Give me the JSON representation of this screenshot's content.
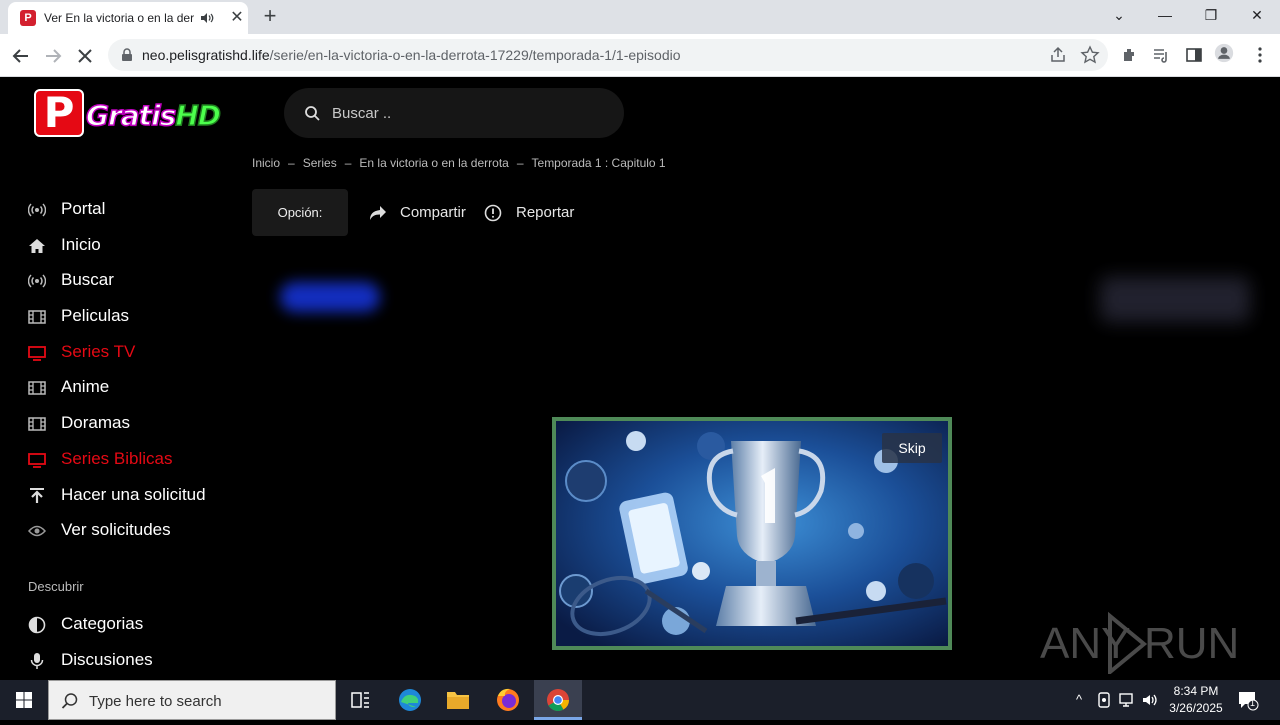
{
  "browser": {
    "tab_title": "Ver En la victoria o en la derrota",
    "url_host": "neo.pelisgratishd.life",
    "url_path": "/serie/en-la-victoria-o-en-la-derrota-17229/temporada-1/1-episodio"
  },
  "site": {
    "logo_letter": "P",
    "logo_text_a": "Gratis",
    "logo_text_b": "HD",
    "search_placeholder": "Buscar .."
  },
  "breadcrumb": [
    "Inicio",
    "Series",
    "En la victoria o en la derrota",
    "Temporada 1 : Capitulo 1"
  ],
  "breadcrumb_sep": "–",
  "actions": {
    "opcion": "Opción:",
    "share": "Compartir",
    "report": "Reportar"
  },
  "nav": [
    {
      "label": "Portal",
      "icon": "broadcast-icon",
      "active": false
    },
    {
      "label": "Inicio",
      "icon": "home-icon",
      "active": false
    },
    {
      "label": "Buscar",
      "icon": "broadcast-icon",
      "active": false
    },
    {
      "label": "Peliculas",
      "icon": "film-icon",
      "active": false
    },
    {
      "label": "Series TV",
      "icon": "tv-icon",
      "active": true
    },
    {
      "label": "Anime",
      "icon": "film-icon",
      "active": false
    },
    {
      "label": "Doramas",
      "icon": "film-icon",
      "active": false
    },
    {
      "label": "Series Biblicas",
      "icon": "tv-icon",
      "active": true
    },
    {
      "label": "Hacer una solicitud",
      "icon": "upload-icon",
      "active": false
    },
    {
      "label": "Ver solicitudes",
      "icon": "eye-icon",
      "active": false
    }
  ],
  "discover": {
    "label": "Descubrir",
    "items": [
      {
        "label": "Categorias",
        "icon": "half-circle-icon"
      },
      {
        "label": "Discusiones",
        "icon": "microphone-icon"
      }
    ]
  },
  "ad": {
    "skip_label": "Skip"
  },
  "watermark": "ANY RUN",
  "taskbar": {
    "search_placeholder": "Type here to search",
    "time": "8:34 PM",
    "date": "3/26/2025",
    "notification_count": "1"
  },
  "colors": {
    "accent_red": "#e50914",
    "ad_border": "#4f8a58"
  }
}
